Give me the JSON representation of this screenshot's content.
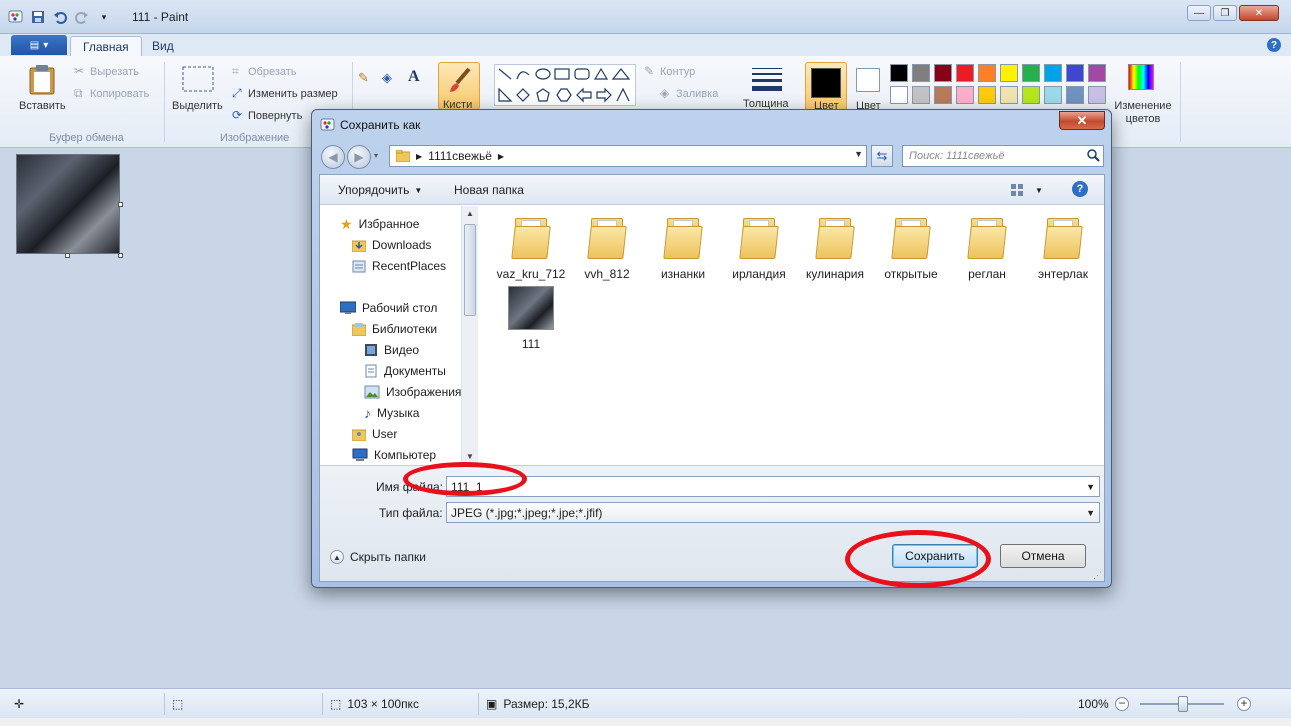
{
  "window": {
    "title": "111 - Paint",
    "tabs": [
      "Главная",
      "Вид"
    ],
    "active_tab": "Главная"
  },
  "ribbon": {
    "clipboard": {
      "group_label": "Буфер обмена",
      "paste": "Вставить",
      "cut": "Вырезать",
      "copy": "Копировать"
    },
    "image": {
      "group_label": "Изображение",
      "select": "Выделить",
      "crop": "Обрезать",
      "resize": "Изменить размер",
      "rotate": "Повернуть"
    },
    "shapes": {
      "outline": "Контур",
      "fill": "Заливка"
    },
    "brushes": "Кисти",
    "size": "Толщина",
    "color1": "Цвет",
    "color2": "Цвет",
    "edit_colors": "Изменение цветов",
    "palette_row1": [
      "#000000",
      "#7f7f7f",
      "#880015",
      "#ed1c24",
      "#ff7f27",
      "#fff200",
      "#22b14c",
      "#00a2e8",
      "#3f48cc",
      "#a349a4"
    ],
    "palette_row2": [
      "#ffffff",
      "#c3c3c3",
      "#b97a57",
      "#ffaec9",
      "#ffc90e",
      "#efe4b0",
      "#b5e61d",
      "#99d9ea",
      "#7092be",
      "#c8bfe7"
    ]
  },
  "status": {
    "dimensions": "103 × 100пкс",
    "size": "Размер: 15,2КБ",
    "zoom": "100%"
  },
  "dialog": {
    "title": "Сохранить как",
    "address": "1111свежьё",
    "search_placeholder": "Поиск: 1111свежьё",
    "toolbar": {
      "organize": "Упорядочить",
      "new_folder": "Новая папка"
    },
    "nav": {
      "favorites": "Избранное",
      "downloads": "Downloads",
      "recent_places": "RecentPlaces",
      "desktop": "Рабочий стол",
      "libraries": "Библиотеки",
      "video": "Видео",
      "documents": "Документы",
      "images": "Изображения",
      "music": "Музыка",
      "user": "User",
      "computer": "Компьютер"
    },
    "files": [
      {
        "name": "vaz_kru_712",
        "type": "folder"
      },
      {
        "name": "vvh_812",
        "type": "folder"
      },
      {
        "name": "изнанки",
        "type": "folder"
      },
      {
        "name": "ирландия",
        "type": "folder"
      },
      {
        "name": "кулинария",
        "type": "folder"
      },
      {
        "name": "открытые",
        "type": "folder"
      },
      {
        "name": "реглан",
        "type": "folder"
      },
      {
        "name": "энтерлак",
        "type": "folder"
      },
      {
        "name": "111",
        "type": "image"
      }
    ],
    "filename_label": "Имя файла:",
    "filename_value": "111_1",
    "filetype_label": "Тип файла:",
    "filetype_value": "JPEG (*.jpg;*.jpeg;*.jpe;*.jfif)",
    "hide_folders": "Скрыть папки",
    "save_button": "Сохранить",
    "cancel_button": "Отмена"
  },
  "colors": {
    "highlight_ring": "#e8101a",
    "folder_yellow": "#f0c75a",
    "accent_blue": "#2b5da7"
  }
}
